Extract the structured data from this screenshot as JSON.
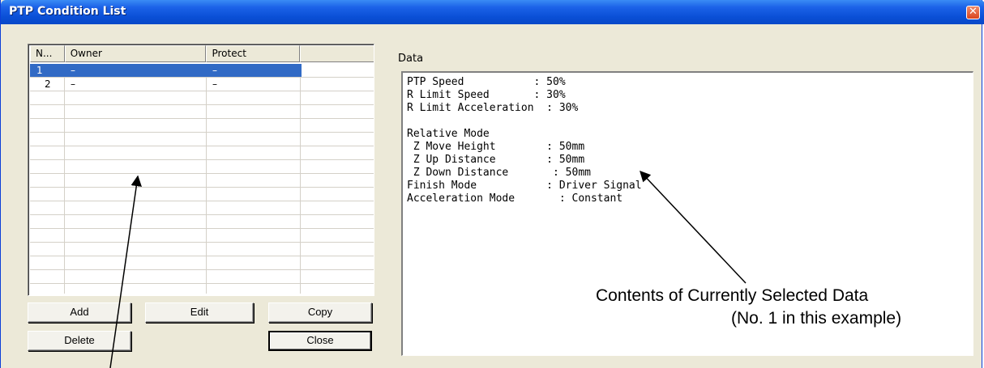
{
  "window": {
    "title": "PTP Condition List",
    "close_glyph": "✕"
  },
  "list": {
    "columns": [
      "N...",
      "Owner",
      "Protect",
      ""
    ],
    "rows": [
      {
        "no": "1",
        "owner": "–",
        "protect": "–",
        "selected": true
      },
      {
        "no": "2",
        "owner": "–",
        "protect": "–",
        "selected": false
      }
    ]
  },
  "buttons": {
    "add": "Add",
    "edit": "Edit",
    "copy": "Copy",
    "delete": "Delete",
    "close": "Close"
  },
  "data_panel": {
    "label": "Data",
    "lines": [
      "PTP Speed           : 50%",
      "R Limit Speed       : 30%",
      "R Limit Acceleration  : 30%",
      "",
      "Relative Mode",
      " Z Move Height        : 50mm",
      " Z Up Distance        : 50mm",
      " Z Down Distance       : 50mm",
      "Finish Mode           : Driver Signal",
      "Acceleration Mode       : Constant"
    ]
  },
  "annotation": {
    "line1": "Contents of Currently Selected Data",
    "line2": "(No. 1 in this example)"
  },
  "colors": {
    "selection": "#316ac5",
    "titlebar": "#0a4fd6",
    "window_bg": "#ece9d8"
  }
}
